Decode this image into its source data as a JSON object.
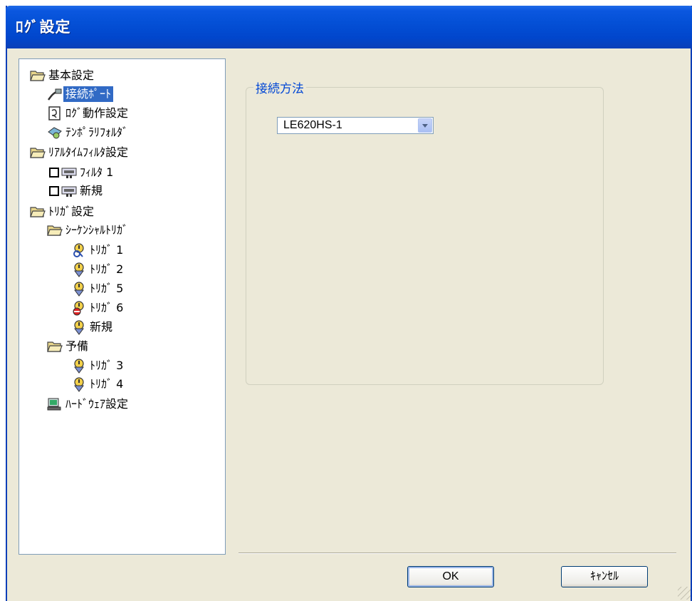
{
  "window": {
    "title": "ﾛｸﾞ設定"
  },
  "tree": {
    "items": [
      {
        "label": "基本設定",
        "icon": "folder-open-icon"
      },
      {
        "label": "接続ﾎﾟｰﾄ",
        "icon": "port-icon",
        "selected": true
      },
      {
        "label": "ﾛｸﾞ動作設定",
        "icon": "log-icon"
      },
      {
        "label": "ﾃﾝﾎﾟﾗﾘﾌｫﾙﾀﾞ",
        "icon": "temp-folder-icon"
      },
      {
        "label": "ﾘｱﾙﾀｲﾑﾌｨﾙﾀ設定",
        "icon": "folder-open-icon"
      },
      {
        "label": "ﾌｨﾙﾀ 1",
        "icon": "filter-icon",
        "checked": false
      },
      {
        "label": "新規",
        "icon": "filter-icon",
        "checked": false
      },
      {
        "label": "ﾄﾘｶﾞ設定",
        "icon": "folder-open-icon"
      },
      {
        "label": "ｼｰｹﾝｼｬﾙﾄﾘｶﾞ",
        "icon": "folder-open-icon"
      },
      {
        "label": "ﾄﾘｶﾞ 1",
        "icon": "trigger-cycle-icon"
      },
      {
        "label": "ﾄﾘｶﾞ 2",
        "icon": "trigger-icon"
      },
      {
        "label": "ﾄﾘｶﾞ 5",
        "icon": "trigger-icon"
      },
      {
        "label": "ﾄﾘｶﾞ 6",
        "icon": "trigger-stop-icon"
      },
      {
        "label": "新規",
        "icon": "trigger-icon"
      },
      {
        "label": "予備",
        "icon": "folder-open-icon"
      },
      {
        "label": "ﾄﾘｶﾞ 3",
        "icon": "trigger-icon"
      },
      {
        "label": "ﾄﾘｶﾞ 4",
        "icon": "trigger-icon"
      },
      {
        "label": "ﾊｰﾄﾞｳｪｱ設定",
        "icon": "hardware-icon"
      }
    ]
  },
  "connection": {
    "group_label": "接続方法",
    "selected_value": "LE620HS-1"
  },
  "buttons": {
    "ok": "OK",
    "cancel": "ｷｬﾝｾﾙ"
  },
  "colors": {
    "titlebar": "#0450d6",
    "dialog_bg": "#ece9d8",
    "selection": "#316ac5",
    "group_label": "#0046d5"
  }
}
